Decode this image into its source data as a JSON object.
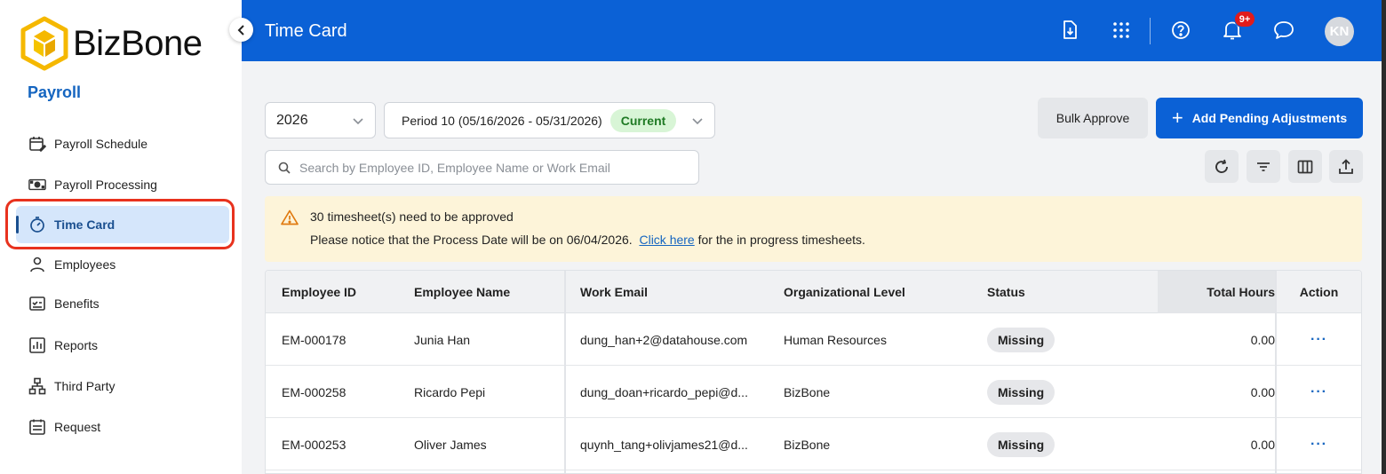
{
  "brand": {
    "name": "BizBone"
  },
  "sidebar": {
    "module_title": "Payroll",
    "items": [
      {
        "label": "Payroll Schedule",
        "icon": "calendar-edit-icon"
      },
      {
        "label": "Payroll Processing",
        "icon": "money-icon"
      },
      {
        "label": "Time Card",
        "icon": "timer-icon",
        "active": true
      },
      {
        "label": "Employees",
        "icon": "person-icon"
      },
      {
        "label": "Benefits",
        "icon": "checklist-icon"
      },
      {
        "label": "Reports",
        "icon": "bar-chart-icon"
      },
      {
        "label": "Third Party",
        "icon": "hierarchy-icon"
      },
      {
        "label": "Request",
        "icon": "form-icon"
      }
    ]
  },
  "header": {
    "title": "Time Card",
    "notification_count": "9+",
    "avatar_initials": "KN",
    "color": "#0b61d6"
  },
  "filters": {
    "year": "2026",
    "period": "Period 10 (05/16/2026 - 05/31/2026)",
    "period_status": "Current",
    "search_placeholder": "Search by Employee ID, Employee Name or Work Email"
  },
  "actions": {
    "bulk_approve": "Bulk Approve",
    "add_pending": "Add Pending Adjustments"
  },
  "alert": {
    "title": "30 timesheet(s) need to be approved",
    "body_prefix": "Please notice that the Process Date will be on 06/04/2026.",
    "link_text": "Click here",
    "body_suffix": "for the in progress timesheets."
  },
  "table": {
    "columns": [
      "Employee ID",
      "Employee Name",
      "Work Email",
      "Organizational Level",
      "Status",
      "Total Hours",
      "Action"
    ],
    "rows": [
      {
        "id": "EM-000178",
        "name": "Junia Han",
        "email": "dung_han+2@datahouse.com",
        "org": "Human Resources",
        "status": "Missing",
        "hours": "0.00",
        "action": "···"
      },
      {
        "id": "EM-000258",
        "name": "Ricardo Pepi",
        "email": "dung_doan+ricardo_pepi@d...",
        "org": "BizBone",
        "status": "Missing",
        "hours": "0.00",
        "action": "···"
      },
      {
        "id": "EM-000253",
        "name": "Oliver James",
        "email": "quynh_tang+olivjames21@d...",
        "org": "BizBone",
        "status": "Missing",
        "hours": "0.00",
        "action": "···"
      }
    ]
  }
}
